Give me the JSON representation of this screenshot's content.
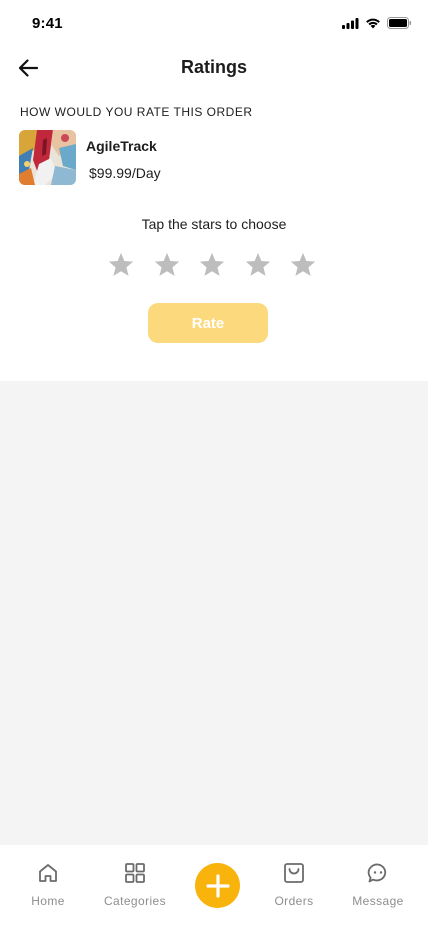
{
  "status_bar": {
    "time": "9:41",
    "icons": [
      "signal-icon",
      "wifi-icon",
      "battery-icon"
    ]
  },
  "header": {
    "back_icon": "arrow-left-icon",
    "title": "Ratings"
  },
  "order": {
    "heading": "HOW WOULD YOU RATE THIS ORDER",
    "product_name": "AgileTrack",
    "product_price": "$99.99/Day"
  },
  "rating": {
    "hint": "Tap the stars to choose",
    "max_stars": 5,
    "selected_stars": 0,
    "star_icon": "star-icon",
    "button_label": "Rate"
  },
  "colors": {
    "accent": "#f9b30d",
    "rate_button_disabled": "#fcd97c",
    "star_inactive": "#bdbdbd",
    "tab_inactive": "#8e8e8e",
    "background_grey": "#f4f4f4"
  },
  "tabbar": {
    "items": [
      {
        "label": "Home",
        "icon": "home-icon"
      },
      {
        "label": "Categories",
        "icon": "grid-icon"
      },
      {
        "label": "",
        "icon": "plus-icon"
      },
      {
        "label": "Orders",
        "icon": "shopping-bag-icon"
      },
      {
        "label": "Message",
        "icon": "chat-bubble-icon"
      }
    ]
  }
}
